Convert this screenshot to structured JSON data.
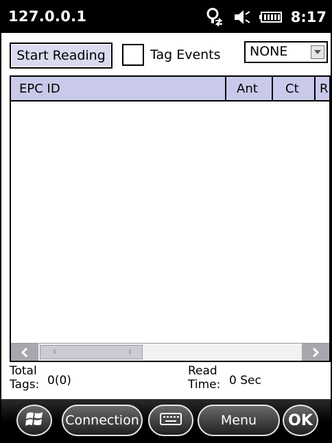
{
  "status_bar": {
    "title": "127.0.0.1",
    "time": "8:17",
    "icons": [
      "connectivity-icon",
      "volume-muted-icon",
      "battery-icon"
    ]
  },
  "toolbar": {
    "start_button": "Start Reading",
    "tag_events_label": "Tag Events",
    "tag_events_checked": false,
    "dropdown_value": "NONE"
  },
  "list": {
    "columns": [
      "EPC ID",
      "Ant",
      "Ct",
      "R"
    ],
    "rows": []
  },
  "stats": {
    "total_tags_label_1": "Total",
    "total_tags_label_2": "Tags:",
    "total_tags_value": "0(0)",
    "read_time_label_1": "Read",
    "read_time_label_2": "Time:",
    "read_time_value": "0 Sec"
  },
  "softkeys": {
    "connection": "Connection",
    "menu": "Menu",
    "ok": "OK"
  },
  "colors": {
    "header_bg": "#c9c9ea",
    "button_bg": "#d9d9ef",
    "statusbar_bg": "#000000"
  }
}
